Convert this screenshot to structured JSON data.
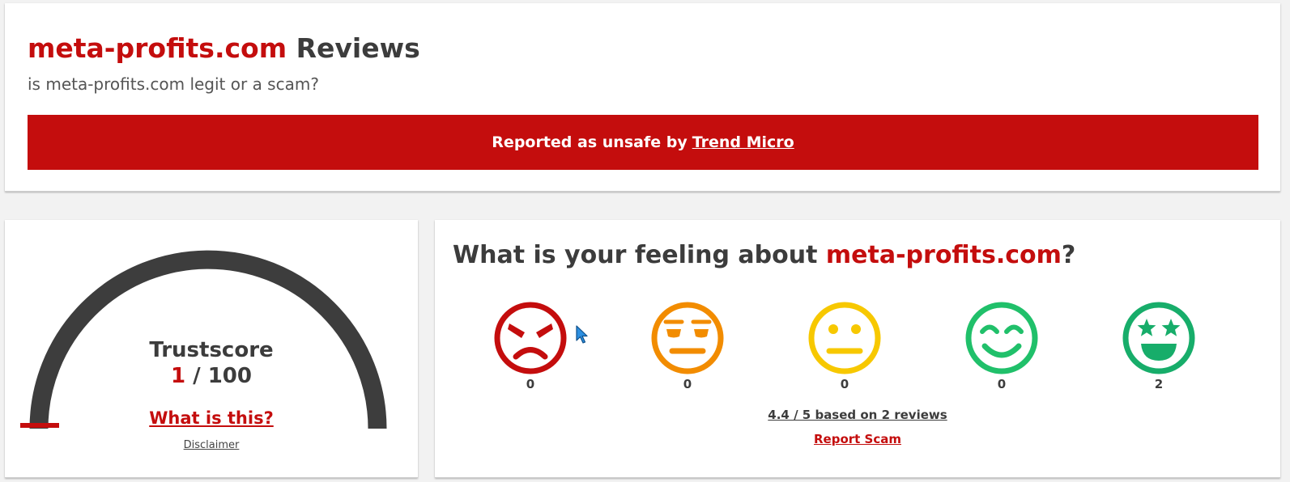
{
  "header": {
    "domain": "meta-profits.com",
    "title_suffix": "Reviews",
    "subtitle": "is meta-profits.com legit or a scam?",
    "banner_text": "Reported as unsafe by",
    "banner_link": "Trend Micro",
    "banner_color": "#c40d0d"
  },
  "trustscore": {
    "label": "Trustscore",
    "score": "1",
    "max": "/ 100",
    "score_value": 1,
    "what_link": "What is this?",
    "disclaimer": "Disclaimer",
    "gauge_color": "#3d3d3d",
    "marker_color": "#c40d0d"
  },
  "feeling": {
    "title_prefix": "What is your feeling about",
    "domain": "meta-profits.com",
    "title_suffix": "?",
    "ratings": [
      {
        "icon": "angry-face-icon",
        "count": "0",
        "color": "#c40d0d"
      },
      {
        "icon": "annoyed-face-icon",
        "count": "0",
        "color": "#f28c00"
      },
      {
        "icon": "neutral-face-icon",
        "count": "0",
        "color": "#f7c800"
      },
      {
        "icon": "smiling-face-icon",
        "count": "0",
        "color": "#20c06a"
      },
      {
        "icon": "star-eyes-face-icon",
        "count": "2",
        "color": "#17ad6a"
      }
    ],
    "summary": "4.4 / 5 based on 2 reviews",
    "report_link": "Report Scam"
  }
}
